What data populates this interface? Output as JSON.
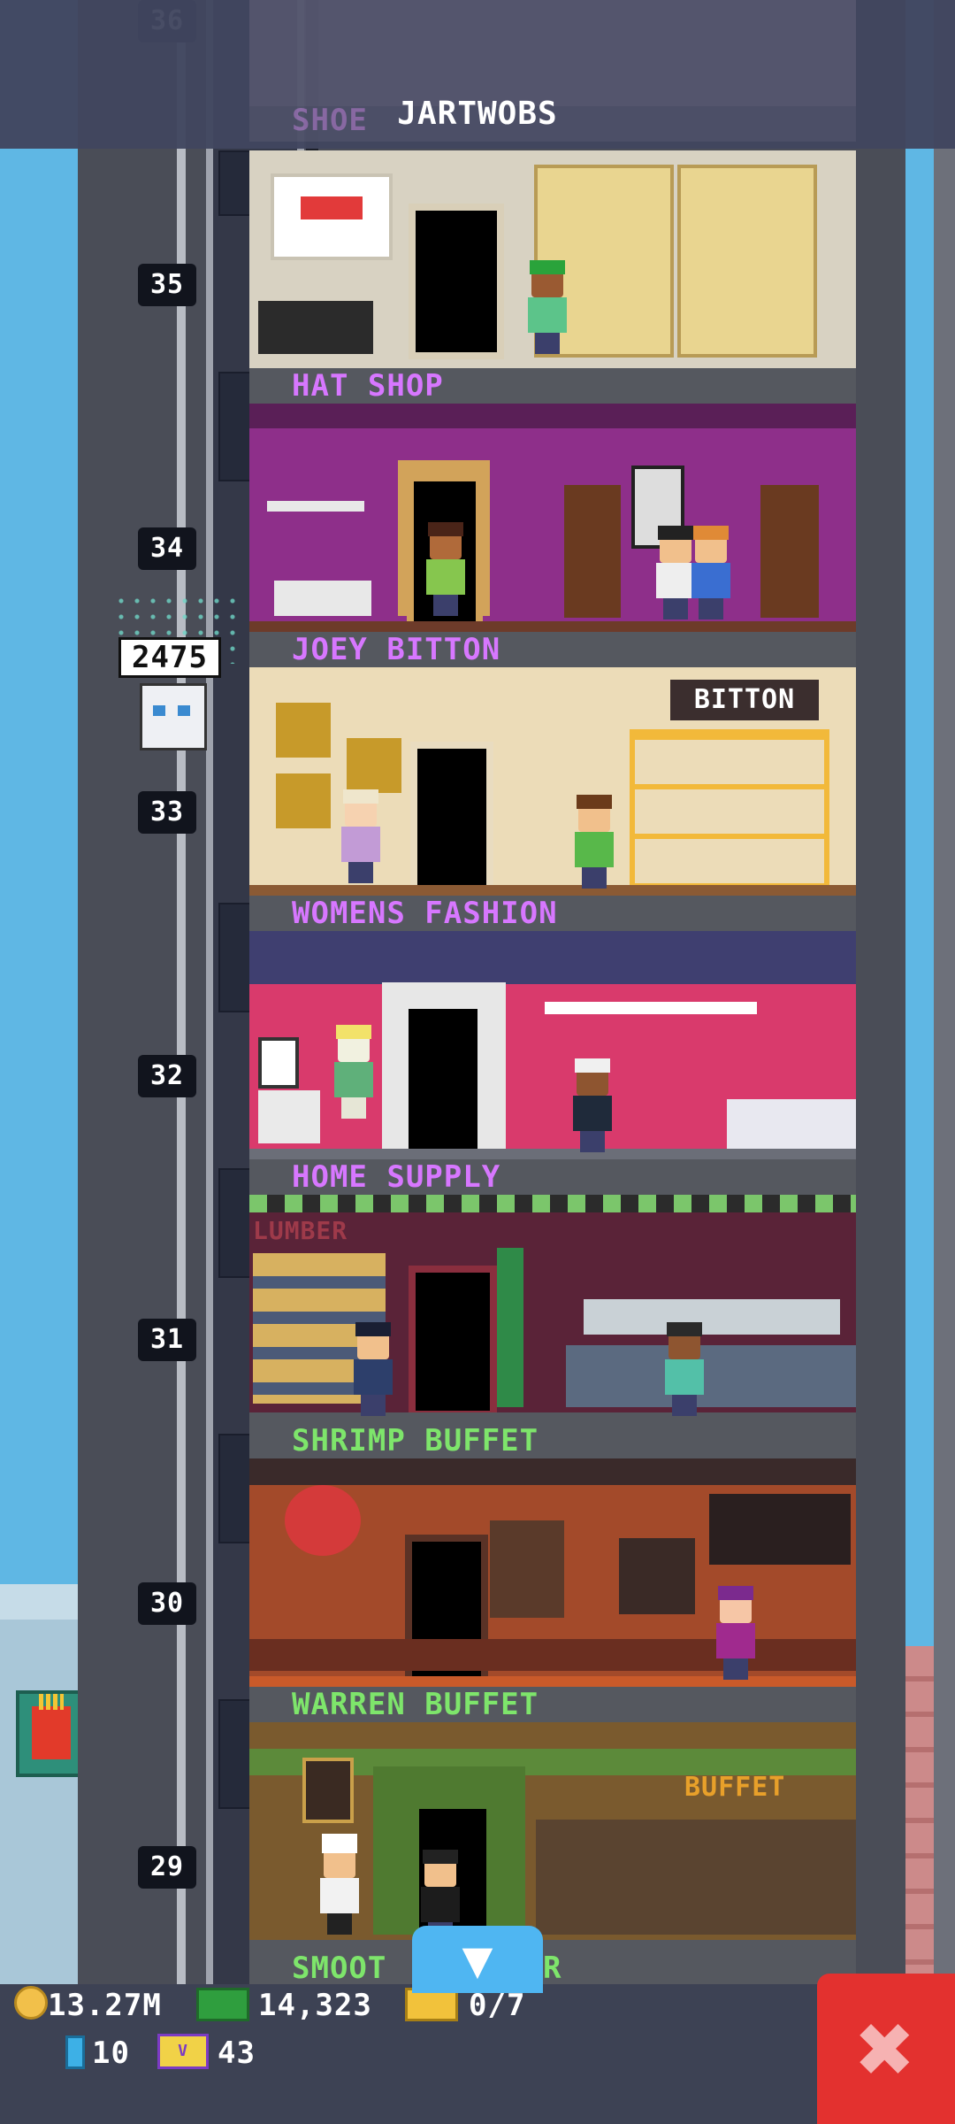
{
  "top": {
    "floor_label": "36",
    "partial_name": "SHOE",
    "name": "JARTWOBS"
  },
  "floors": [
    {
      "number": "35",
      "name": "HAT SHOP",
      "name_color": "#d777ff"
    },
    {
      "number": "34",
      "name": "JOEY BITTON",
      "name_color": "#d777ff"
    },
    {
      "number": "33",
      "name": "WOMENS FASHION",
      "name_color": "#d777ff",
      "sign": "BITTON"
    },
    {
      "number": "32",
      "name": "HOME SUPPLY",
      "name_color": "#d777ff"
    },
    {
      "number": "31",
      "name": "SHRIMP BUFFET",
      "name_color": "#7ee56b",
      "sign": "LUMBER"
    },
    {
      "number": "30",
      "name": "WARREN BUFFET",
      "name_color": "#7ee56b"
    },
    {
      "number": "29",
      "name": "SMOOT",
      "name_color": "#7ee56b",
      "sign": "BUFFET",
      "name_tail": "R"
    }
  ],
  "elevator": {
    "passenger_count": "2475"
  },
  "hud": {
    "coins": "13.27M",
    "bux": "14,323",
    "tickets": "0/7",
    "bitizens": "10",
    "vip": "43",
    "vip_icon_text": "V"
  },
  "icons": {
    "down": "down-arrow-icon",
    "close": "close-icon"
  },
  "colors": {
    "sky": "#5fb7e4",
    "close_button": "#e3312f",
    "down_button": "#4fb6f2"
  }
}
